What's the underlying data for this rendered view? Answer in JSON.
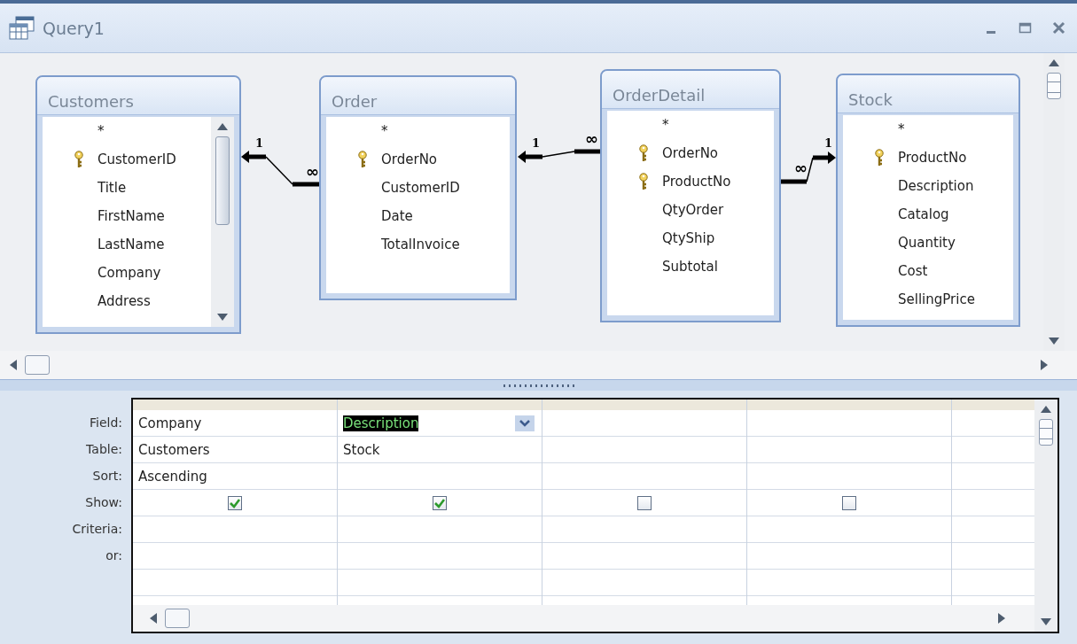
{
  "window": {
    "title": "Query1"
  },
  "tables": [
    {
      "name": "Customers",
      "scrollable": true,
      "fields": [
        {
          "name": "*",
          "key": false
        },
        {
          "name": "CustomerID",
          "key": true
        },
        {
          "name": "Title",
          "key": false
        },
        {
          "name": "FirstName",
          "key": false
        },
        {
          "name": "LastName",
          "key": false
        },
        {
          "name": "Company",
          "key": false
        },
        {
          "name": "Address",
          "key": false
        }
      ]
    },
    {
      "name": "Order",
      "scrollable": false,
      "fields": [
        {
          "name": "*",
          "key": false
        },
        {
          "name": "OrderNo",
          "key": true
        },
        {
          "name": "CustomerID",
          "key": false
        },
        {
          "name": "Date",
          "key": false
        },
        {
          "name": "TotalInvoice",
          "key": false
        }
      ]
    },
    {
      "name": "OrderDetail",
      "scrollable": false,
      "fields": [
        {
          "name": "*",
          "key": false
        },
        {
          "name": "OrderNo",
          "key": true
        },
        {
          "name": "ProductNo",
          "key": true
        },
        {
          "name": "QtyOrder",
          "key": false
        },
        {
          "name": "QtyShip",
          "key": false
        },
        {
          "name": "Subtotal",
          "key": false
        }
      ]
    },
    {
      "name": "Stock",
      "scrollable": false,
      "fields": [
        {
          "name": "*",
          "key": false
        },
        {
          "name": "ProductNo",
          "key": true
        },
        {
          "name": "Description",
          "key": false
        },
        {
          "name": "Catalog",
          "key": false
        },
        {
          "name": "Quantity",
          "key": false
        },
        {
          "name": "Cost",
          "key": false
        },
        {
          "name": "SellingPrice",
          "key": false
        }
      ]
    }
  ],
  "joins": [
    {
      "one_label": "1",
      "many_label": "∞"
    },
    {
      "one_label": "1",
      "many_label": "∞"
    },
    {
      "one_label": "1",
      "many_label": "∞"
    }
  ],
  "grid": {
    "row_labels": [
      "Field:",
      "Table:",
      "Sort:",
      "Show:",
      "Criteria:",
      "or:"
    ],
    "columns": [
      {
        "field": "Company",
        "table": "Customers",
        "sort": "Ascending",
        "show": true,
        "selected": false
      },
      {
        "field": "Description",
        "table": "Stock",
        "show": true,
        "selected": true
      },
      {
        "show": false,
        "selected": false
      },
      {
        "show": false,
        "selected": false
      }
    ]
  }
}
